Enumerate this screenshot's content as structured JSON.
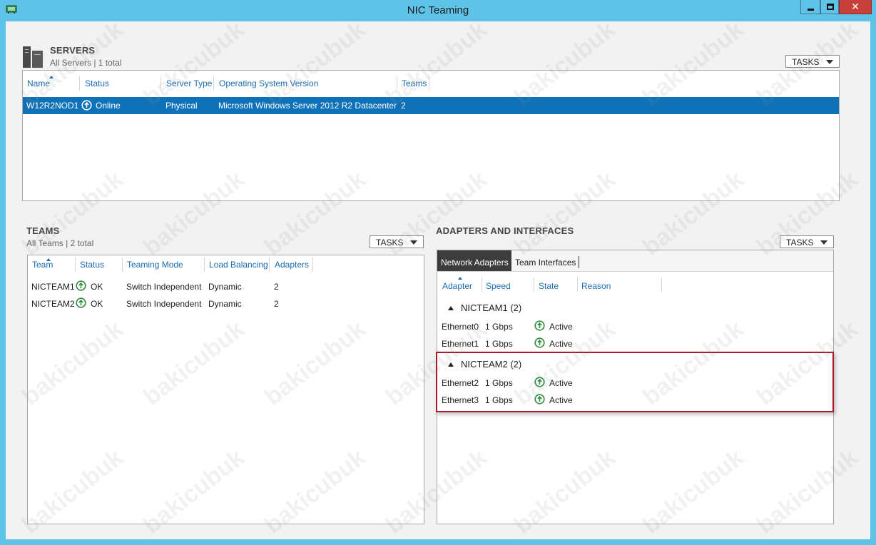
{
  "window": {
    "title": "NIC Teaming",
    "close_glyph": "✕"
  },
  "servers": {
    "title": "SERVERS",
    "subtitle": "All Servers | 1 total",
    "tasks_label": "TASKS",
    "columns": [
      "Name",
      "Status",
      "Server Type",
      "Operating System Version",
      "Teams"
    ],
    "rows": [
      {
        "name": "W12R2NOD1",
        "status": "Online",
        "server_type": "Physical",
        "os": "Microsoft Windows Server 2012 R2 Datacenter",
        "teams": "2"
      }
    ]
  },
  "teams": {
    "title": "TEAMS",
    "subtitle": "All Teams | 2 total",
    "tasks_label": "TASKS",
    "columns": [
      "Team",
      "Status",
      "Teaming Mode",
      "Load Balancing",
      "Adapters"
    ],
    "rows": [
      {
        "team": "NICTEAM1",
        "status": "OK",
        "mode": "Switch Independent",
        "balancing": "Dynamic",
        "adapters": "2"
      },
      {
        "team": "NICTEAM2",
        "status": "OK",
        "mode": "Switch Independent",
        "balancing": "Dynamic",
        "adapters": "2"
      }
    ]
  },
  "adapters": {
    "title": "ADAPTERS AND INTERFACES",
    "tasks_label": "TASKS",
    "tabs": [
      "Network Adapters",
      "Team Interfaces"
    ],
    "columns": [
      "Adapter",
      "Speed",
      "State",
      "Reason"
    ],
    "groups": [
      {
        "label": "NICTEAM1 (2)",
        "items": [
          {
            "adapter": "Ethernet0",
            "speed": "1 Gbps",
            "state": "Active"
          },
          {
            "adapter": "Ethernet1",
            "speed": "1 Gbps",
            "state": "Active"
          }
        ]
      },
      {
        "label": "NICTEAM2 (2)",
        "items": [
          {
            "adapter": "Ethernet2",
            "speed": "1 Gbps",
            "state": "Active"
          },
          {
            "adapter": "Ethernet3",
            "speed": "1 Gbps",
            "state": "Active"
          }
        ]
      }
    ]
  },
  "watermark": "bakicubuk",
  "colors": {
    "accent": "#1c6cb2",
    "selection": "#0f72b8",
    "titlebar": "#5fc3e8",
    "status_green": "#2e8b3a",
    "highlight": "#b0162a"
  },
  "icons": {
    "status": "up-arrow-circle-icon",
    "app": "network-card-icon",
    "servers": "server-tower-icon"
  }
}
